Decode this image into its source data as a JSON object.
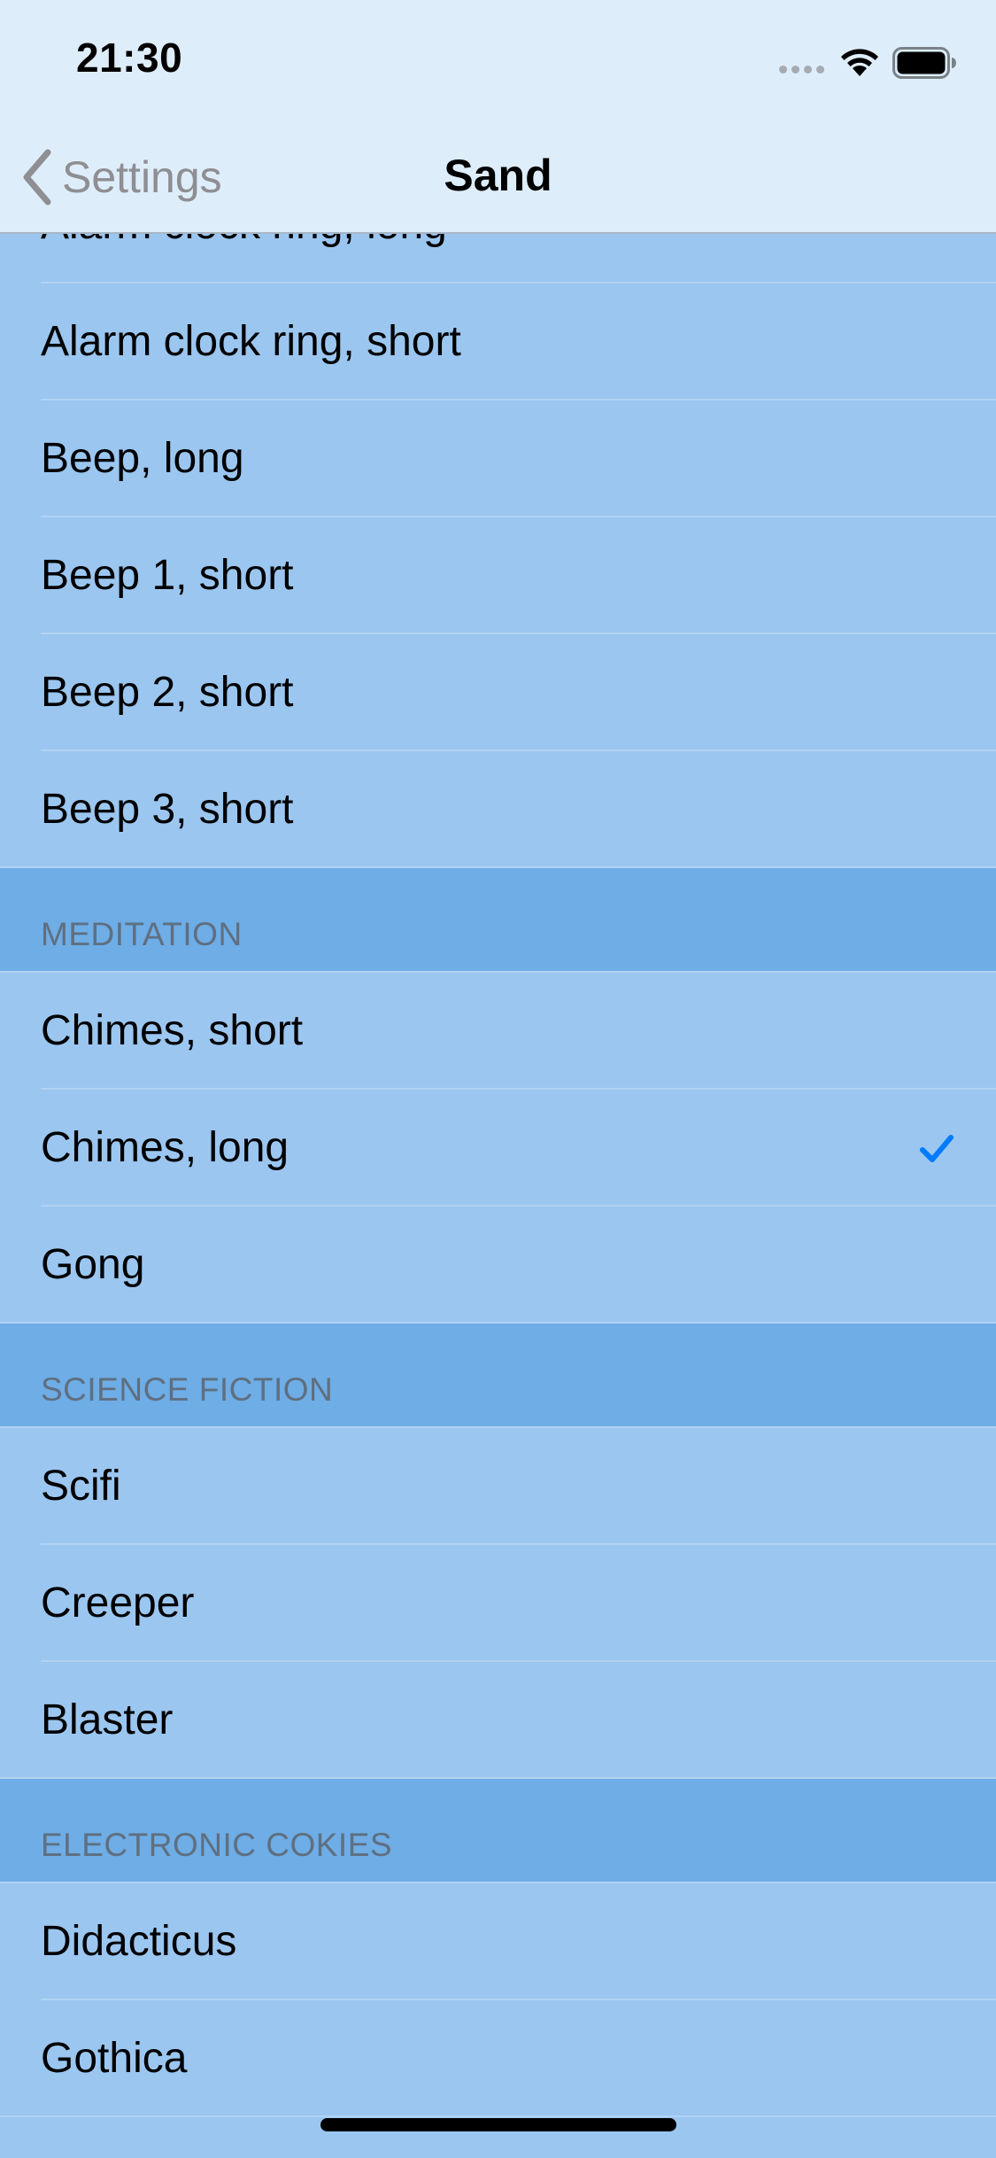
{
  "status_bar": {
    "time": "21:30"
  },
  "nav": {
    "back_label": "Settings",
    "title": "Sand"
  },
  "colors": {
    "accent": "#007aff",
    "row_background": "#9bc6f0",
    "section_header_background": "#6eade6",
    "bar_background": "#deedfa"
  },
  "sections": [
    {
      "header": "",
      "items": [
        {
          "label": "Alarm clock ring, long",
          "selected": false
        },
        {
          "label": "Alarm clock ring, short",
          "selected": false
        },
        {
          "label": "Beep, long",
          "selected": false
        },
        {
          "label": "Beep 1, short",
          "selected": false
        },
        {
          "label": "Beep 2, short",
          "selected": false
        },
        {
          "label": "Beep 3, short",
          "selected": false
        }
      ]
    },
    {
      "header": "MEDITATION",
      "items": [
        {
          "label": "Chimes, short",
          "selected": false
        },
        {
          "label": "Chimes, long",
          "selected": true
        },
        {
          "label": "Gong",
          "selected": false
        }
      ]
    },
    {
      "header": "SCIENCE FICTION",
      "items": [
        {
          "label": "Scifi",
          "selected": false
        },
        {
          "label": "Creeper",
          "selected": false
        },
        {
          "label": "Blaster",
          "selected": false
        }
      ]
    },
    {
      "header": "ELECTRONIC COKIES",
      "items": [
        {
          "label": "Didacticus",
          "selected": false
        },
        {
          "label": "Gothica",
          "selected": false
        }
      ]
    }
  ]
}
